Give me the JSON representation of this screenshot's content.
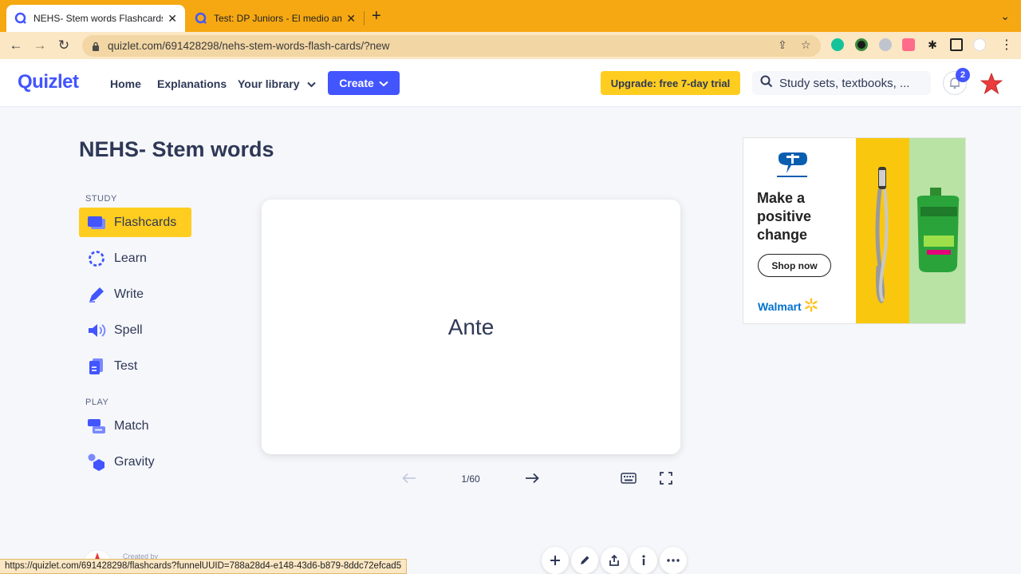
{
  "browser": {
    "tabs": [
      {
        "title": "NEHS- Stem words Flashcards",
        "active": true
      },
      {
        "title": "Test: DP Juniors - El medio am",
        "active": false
      }
    ],
    "url": "quizlet.com/691428298/nehs-stem-words-flash-cards/?new",
    "status_url": "https://quizlet.com/691428298/flashcards?funnelUUID=788a28d4-e148-43d6-b879-8ddc72efcad5"
  },
  "header": {
    "logo": "Quizlet",
    "nav": {
      "home": "Home",
      "explanations": "Explanations",
      "library": "Your library"
    },
    "create_label": "Create",
    "upgrade_label": "Upgrade: free 7-day trial",
    "search_placeholder": "Study sets, textbooks, ...",
    "notification_count": "2"
  },
  "set": {
    "title": "NEHS- Stem words"
  },
  "sidebar": {
    "study_label": "STUDY",
    "play_label": "PLAY",
    "study_modes": [
      {
        "label": "Flashcards",
        "icon": "flashcards-icon",
        "active": true
      },
      {
        "label": "Learn",
        "icon": "learn-icon"
      },
      {
        "label": "Write",
        "icon": "write-icon"
      },
      {
        "label": "Spell",
        "icon": "spell-icon"
      },
      {
        "label": "Test",
        "icon": "test-icon"
      }
    ],
    "play_modes": [
      {
        "label": "Match",
        "icon": "match-icon"
      },
      {
        "label": "Gravity",
        "icon": "gravity-icon"
      }
    ]
  },
  "flashcard": {
    "term": "Ante",
    "counter": "1/60"
  },
  "ad": {
    "headline_1": "Make a",
    "headline_2": "positive",
    "headline_3": "change",
    "cta": "Shop now",
    "brand": "Walmart"
  },
  "footer": {
    "created_by": "Created by"
  },
  "colors": {
    "brand_blue": "#4255ff",
    "highlight_yellow": "#ffcd1f",
    "browser_orange": "#f6a812"
  }
}
